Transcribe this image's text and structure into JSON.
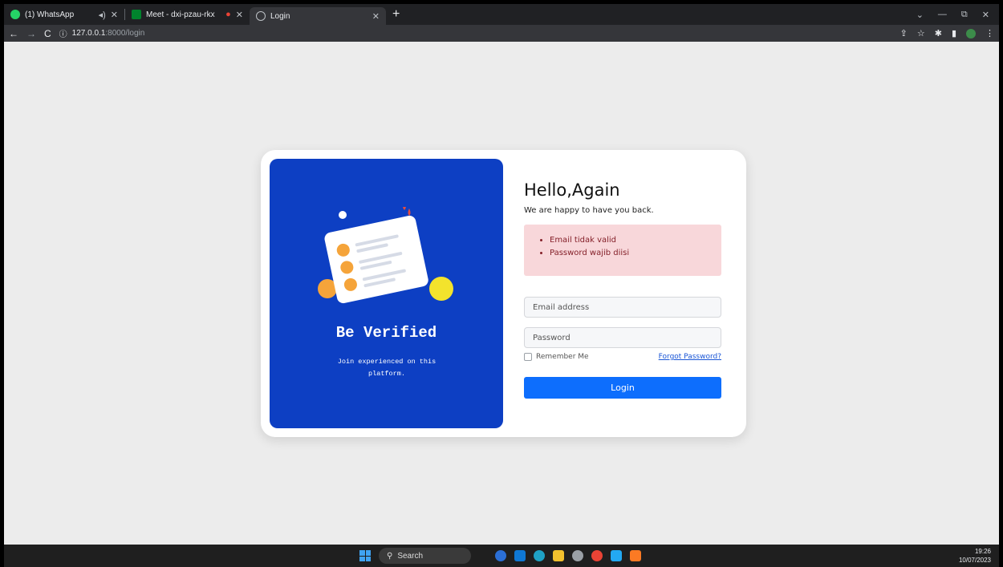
{
  "browser": {
    "tabs": [
      {
        "title": "(1) WhatsApp"
      },
      {
        "title": "Meet - dxi-pzau-rkx"
      },
      {
        "title": "Login"
      }
    ],
    "url_host": "127.0.0.1",
    "url_path": ":8000/login"
  },
  "hero": {
    "title": "Be Verified",
    "subtitle": "Join experienced on this platform."
  },
  "form": {
    "heading": "Hello,Again",
    "subheading": "We are happy to have you back.",
    "errors": [
      "Email tidak valid",
      "Password wajib diisi"
    ],
    "email_placeholder": "Email address",
    "password_placeholder": "Password",
    "remember_label": "Remember Me",
    "forgot_label": "Forgot Password?",
    "login_label": "Login"
  },
  "taskbar": {
    "search_label": "Search",
    "time": "19:26",
    "date": "10/07/2023"
  },
  "colors": {
    "hero_bg": "#0d3fc3",
    "alert_bg": "#f8d7da",
    "button_bg": "#0d6efd"
  }
}
